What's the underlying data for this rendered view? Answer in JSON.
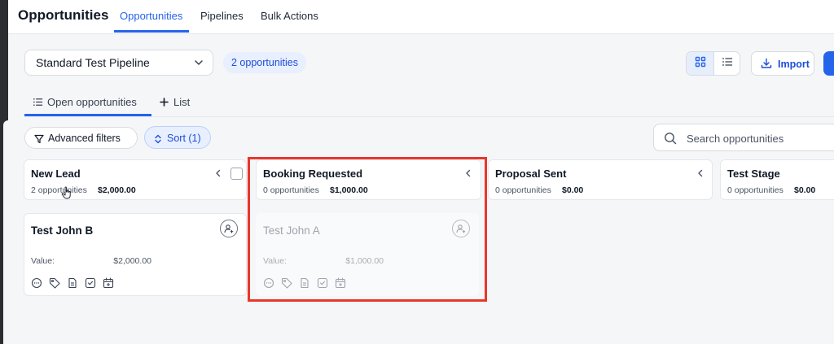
{
  "header": {
    "title": "Opportunities",
    "tabs": [
      "Opportunities",
      "Pipelines",
      "Bulk Actions"
    ]
  },
  "toolbar": {
    "pipeline": "Standard Test Pipeline",
    "count_pill": "2 opportunities",
    "import_label": "Import"
  },
  "subtabs": {
    "open": "Open opportunities",
    "list": "List"
  },
  "filters": {
    "advanced": "Advanced filters",
    "sort": "Sort (1)",
    "search_placeholder": "Search opportunities"
  },
  "columns": [
    {
      "name": "New Lead",
      "count": "2 opportunities",
      "amount": "$2,000.00"
    },
    {
      "name": "Booking Requested",
      "count": "0 opportunities",
      "amount": "$1,000.00"
    },
    {
      "name": "Proposal Sent",
      "count": "0 opportunities",
      "amount": "$0.00"
    },
    {
      "name": "Test Stage",
      "count": "0 opportunities",
      "amount": "$0.00"
    }
  ],
  "cards": [
    {
      "title": "Test John B",
      "value_label": "Value:",
      "value": "$2,000.00"
    },
    {
      "title": "Test John A",
      "value_label": "Value:",
      "value": "$1,000.00"
    }
  ],
  "colors": {
    "accent": "#2563eb",
    "highlight": "#e8372b"
  }
}
